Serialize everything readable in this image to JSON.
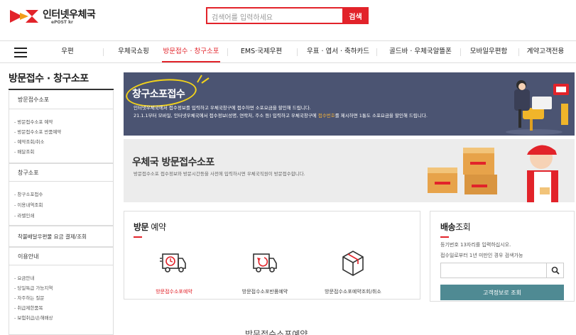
{
  "header": {
    "logo_main": "인터넷우체국",
    "logo_sub": "ePOST kr",
    "search_placeholder": "검색어를 입력하세요",
    "search_button": "검색"
  },
  "gnb": {
    "items": [
      "우편",
      "우체국쇼핑",
      "방문접수 · 창구소포",
      "EMS·국제우편",
      "우표 · 엽서 · 축하카드",
      "골드바 · 우체국알뜰폰",
      "모바일우편함",
      "계약고객전용"
    ],
    "active_index": 2
  },
  "sidebar": {
    "title": "방문접수 · 창구소포",
    "groups": [
      {
        "label": "방문접수소포",
        "items": [
          "방문접수소포 예약",
          "방문접수소포 반품예약",
          "예약조회/취소",
          "배달조회"
        ]
      },
      {
        "label": "창구소포",
        "items": [
          "창구소포접수",
          "이용내역조회",
          "라벨인쇄"
        ]
      },
      {
        "label": "착불배달우편물 요금 결제/조회",
        "items": []
      },
      {
        "label": "이용안내",
        "items": [
          "요금안내",
          "당일특급 가능지역",
          "자주하는 질문",
          "취급제한품목",
          "보험취급/손해배상"
        ]
      }
    ]
  },
  "banner1": {
    "title": "창구소포접수",
    "line1": "인터넷우체국에서 접수정보를 입력하고 우체국창구에 접수하면 소포요금을 할인해 드립니다.",
    "line2_pre": "21.1.1부터 모바일, 인터넷우체국에서 접수정보(성명, 연락처, 주소 등) 입력하고 우체국창구에 ",
    "line2_highlight": "접수번호",
    "line2_post": "를 제시하면 1통도 소포요금을 할인해 드립니다.",
    "colors": {
      "bg": "#4b5472",
      "highlight": "#f3b23a"
    }
  },
  "banner2": {
    "title": "우체국 방문접수소포",
    "desc": "방문접수소포 접수정보와 방문시간등을 사전에 입력하시면 우체국직원이 방문접수합니다."
  },
  "visit": {
    "title_bold": "방문",
    "title_rest": " 예약",
    "items": [
      {
        "label": "방문접수소포예약",
        "icon": "truck-clock-icon"
      },
      {
        "label": "방문접수소포반품예약",
        "icon": "truck-return-icon"
      },
      {
        "label": "방문접수소포예약조회/취소",
        "icon": "box-icon"
      }
    ]
  },
  "tracking": {
    "title_bold": "배송",
    "title_rest": "조회",
    "desc1": "등기번호 13자리를 입력하십시오.",
    "desc2": "접수일로부터 1년 미만인 경우 검색가능",
    "button": "고객정보로 조회"
  },
  "caption": "방문접수소포예약",
  "colors": {
    "brand_red": "#e2232a",
    "teal": "#4f8a93"
  }
}
